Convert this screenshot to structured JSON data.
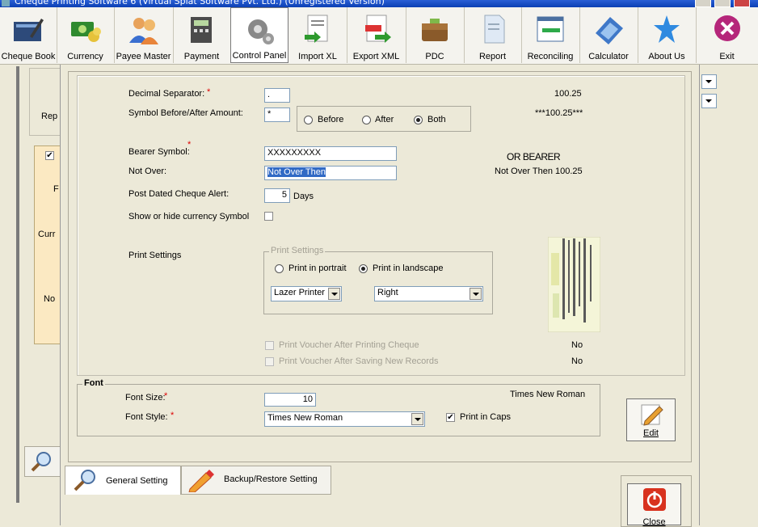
{
  "window": {
    "title": "Cheque Printing Software 6 (Virtual Splat Software Pvt. Ltd.) (Unregistered Version)"
  },
  "toolbar": {
    "items": [
      {
        "label": "Cheque Book",
        "icon": "cheque-book-icon"
      },
      {
        "label": "Currency",
        "icon": "currency-icon"
      },
      {
        "label": "Payee Master",
        "icon": "payee-icon"
      },
      {
        "label": "Payment",
        "icon": "payment-icon"
      },
      {
        "label": "Control Panel",
        "icon": "control-panel-icon"
      },
      {
        "label": "Import XL",
        "icon": "import-xl-icon"
      },
      {
        "label": "Export XML",
        "icon": "export-xml-icon"
      },
      {
        "label": "PDC",
        "icon": "pdc-icon"
      },
      {
        "label": "Report",
        "icon": "report-icon"
      },
      {
        "label": "Reconciling",
        "icon": "reconciling-icon"
      },
      {
        "label": "Calculator",
        "icon": "calculator-icon"
      },
      {
        "label": "About Us",
        "icon": "about-icon"
      },
      {
        "label": "Exit",
        "icon": "exit-icon"
      }
    ]
  },
  "background": {
    "rep_label": "Rep",
    "f_label": "F",
    "curr_label": "Curr",
    "no_label": "No"
  },
  "general": {
    "decimal_separator_label": "Decimal Separator:",
    "required_mark": "*",
    "decimal_separator_value": ".",
    "decimal_preview": "100.25",
    "symbol_label": "Symbol Before/After Amount:",
    "symbol_value": "*",
    "symbol_options": [
      "Before",
      "After",
      "Both"
    ],
    "symbol_selected": "Both",
    "symbol_preview": "***100.25***",
    "bearer_label": "Bearer Symbol:",
    "bearer_value": "XXXXXXXXX",
    "bearer_preview": "OR BEARER",
    "not_over_label": "Not Over:",
    "not_over_value": "Not Over Then",
    "not_over_preview": "Not Over Then 100.25",
    "post_dated_label": "Post Dated Cheque Alert:",
    "post_dated_value": "5",
    "post_dated_unit": "Days",
    "show_currency_label": "Show or hide currency Symbol",
    "print_settings_label": "Print Settings",
    "print_group_legend": "Print Settings",
    "orientation_options": [
      "Print in portrait",
      "Print in landscape"
    ],
    "orientation_selected": "Print in landscape",
    "printer_type": "Lazer Printer",
    "alignment": "Right",
    "voucher_print_label": "Print Voucher After Printing Cheque",
    "voucher_print_value": "No",
    "voucher_save_label": "Print Voucher After Saving New Records",
    "voucher_save_value": "No"
  },
  "font": {
    "legend": "Font",
    "size_label": "Font Size:",
    "size_value": "10",
    "style_label": "Font Style:",
    "style_value": "Times New Roman",
    "preview": "Times New Roman",
    "caps_label": "Print in Caps",
    "caps_checked": true,
    "edit_label": "Edit"
  },
  "tabs": [
    {
      "label": "General Setting",
      "active": true
    },
    {
      "label": "Backup/Restore Setting",
      "active": false
    }
  ],
  "close_label": "Close"
}
